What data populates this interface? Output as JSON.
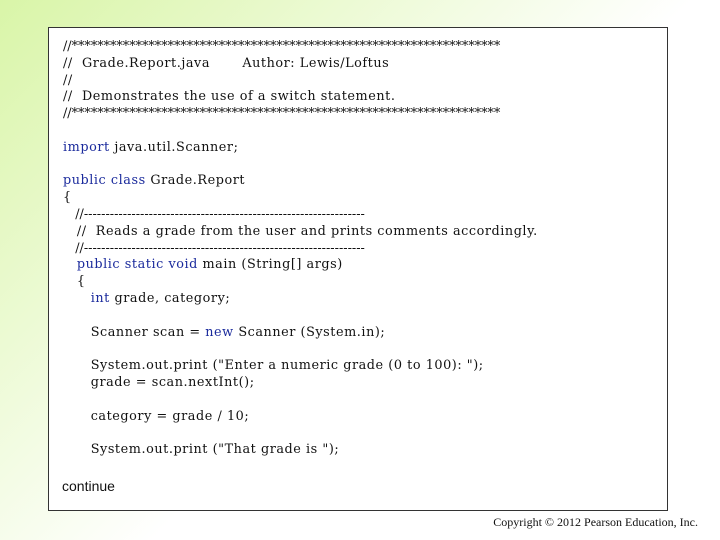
{
  "code_lines": [
    "//*******************************************************************",
    "//  Grade.Report.java       Author: Lewis/Loftus",
    "//",
    "//  Demonstrates the use of a switch statement.",
    "//*******************************************************************",
    "",
    "import java.util.Scanner;",
    "",
    "public class Grade.Report",
    "{",
    "   //-----------------------------------------------------------------",
    "   //  Reads a grade from the user and prints comments accordingly.",
    "   //-----------------------------------------------------------------",
    "   public static void main (String[] args)",
    "   {",
    "      int grade, category;",
    "",
    "      Scanner scan = new Scanner (System.in);",
    "",
    "      System.out.print (\"Enter a numeric grade (0 to 100): \");",
    "      grade = scan.nextInt();",
    "",
    "      category = grade / 10;",
    "",
    "      System.out.print (\"That grade is \");"
  ],
  "keywords": [
    "import",
    "public",
    "class",
    "static",
    "void",
    "int",
    "new"
  ],
  "keyword_color": "#1a2a9c",
  "continue_label": "continue",
  "copyright": "Copyright © 2012 Pearson Education, Inc."
}
